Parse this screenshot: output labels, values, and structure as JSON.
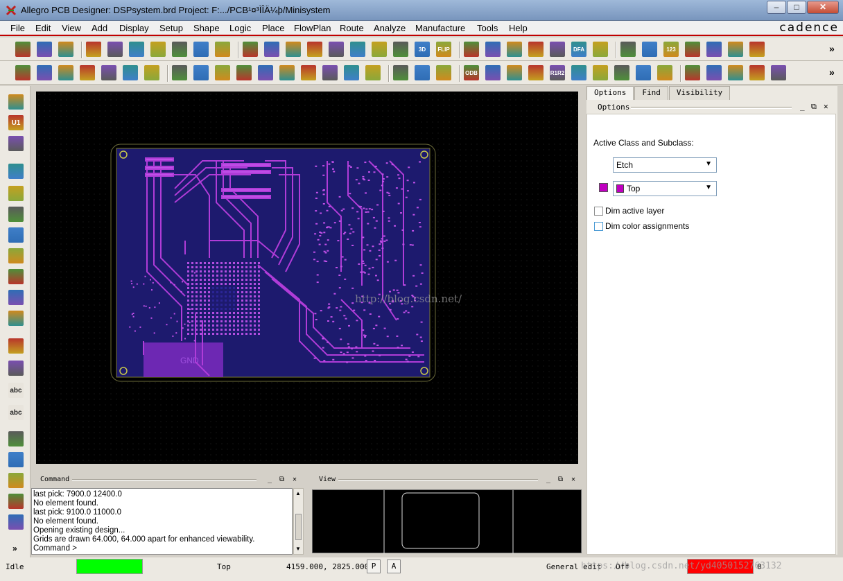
{
  "window": {
    "title": "Allegro PCB Designer: DSPsystem.brd  Project: F:.../PCB¹¤³ÌÎÄ¼þ/Minisystem",
    "minimize": "–",
    "maximize": "□",
    "close": "✕"
  },
  "menu": {
    "items": [
      "File",
      "Edit",
      "View",
      "Add",
      "Display",
      "Setup",
      "Shape",
      "Logic",
      "Place",
      "FlowPlan",
      "Route",
      "Analyze",
      "Manufacture",
      "Tools",
      "Help"
    ],
    "brand": "cadence"
  },
  "toolbar1": {
    "icons": [
      "new-icon",
      "open-icon",
      "save-icon",
      "move-icon",
      "copy-icon",
      "delete-icon",
      "undo-icon",
      "redo-icon",
      "add-connect-icon",
      "fix-icon",
      "grid-icon",
      "zoom-fit-icon",
      "zoom-points-icon",
      "zoom-in-icon",
      "zoom-out-icon",
      "zoom-prev-icon",
      "zoom-world-icon",
      "redraw-icon",
      "3d-icon",
      "flip-icon",
      "grid-display-icon",
      "color-icon",
      "layer-icon",
      "shape-fill-icon",
      "drc-icon",
      "dfa-icon",
      "3d-view-icon",
      "info-icon",
      "measure-icon",
      "label-123-icon",
      "highlight-icon",
      "sun-icon",
      "dehighlight-icon",
      "report-icon"
    ],
    "label_3d": "3D",
    "label_flip": "FLIP",
    "label_dfa": "DFA",
    "label_123": "123",
    "overflow": "»"
  },
  "toolbar2": {
    "icons": [
      "etch-icon-1",
      "etch-icon-2",
      "etch-icon-3",
      "etch-icon-4",
      "etch-icon-5",
      "etch-icon-6",
      "etch-icon-7",
      "line-icon",
      "rect-icon",
      "circle-icon",
      "select-icon",
      "shape-icon-1",
      "shape-icon-2",
      "shape-icon-3",
      "shape-icon-4",
      "shape-icon-5",
      "shape-icon-6",
      "place-icon",
      "dimension-icon",
      "dimension-2-icon",
      "odb-icon",
      "book-icon",
      "script-icon",
      "camera-icon",
      "refdes-icon",
      "flag-icon",
      "matrix-icon",
      "key-icon",
      "array-icon",
      "grid-array-icon",
      "wave-icon",
      "doc-icon",
      "doc-2-icon",
      "doc-3-icon",
      "window-icon"
    ],
    "label_odb": "ODB",
    "label_r1r2": "R1R2",
    "overflow": "»"
  },
  "left_toolbar": {
    "icons": [
      "place-manual-icon",
      "u1-icon",
      "component-icon",
      "add-line-icon",
      "slide-icon",
      "delay-tune-icon",
      "fanout-icon",
      "connect-icon",
      "bus-icon",
      "gloss-icon",
      "custom-smooth-icon",
      "line-draw-icon",
      "rectangle-icon",
      "text-add-icon",
      "text-edit-icon",
      "route-1-icon",
      "route-2-icon",
      "route-3-icon",
      "route-4-icon",
      "route-5-icon"
    ],
    "label_u1": "U1",
    "label_abc": "abc",
    "overflow": "»"
  },
  "canvas": {
    "watermark": "http://blog.csdn.net/",
    "silk_label": "GND"
  },
  "right_panel": {
    "tabs": [
      "Options",
      "Find",
      "Visibility"
    ],
    "panel_title": "Options",
    "active_class_label": "Active Class and Subclass:",
    "class_value": "Etch",
    "subclass_value": "Top",
    "subclass_color": "#c000c0",
    "dim_active_layer": "Dim active layer",
    "dim_color_assignments": "Dim color assignments",
    "dim_active_layer_checked": false,
    "dim_color_assignments_checked": false
  },
  "command_pane": {
    "title": "Command",
    "lines": [
      "last pick:  7900.0 12400.0",
      "No element found.",
      "last pick:  9100.0 11000.0",
      "No element found.",
      "Opening existing design...",
      "Grids are drawn 64.000, 64.000 apart for enhanced viewability.",
      "Command >"
    ]
  },
  "view_pane": {
    "title": "View"
  },
  "pane_controls": {
    "minimize": "_",
    "restore": "⧉",
    "close": "✕"
  },
  "status": {
    "state": "Idle",
    "layer": "Top",
    "coords": "4159.000, 2825.000",
    "p_button": "P",
    "a_button": "A",
    "mode": "General edit",
    "off": "Off",
    "drc_count": "0",
    "watermark": "https://blog.csdn.net/yd4050152763132",
    "idle_color": "#00ff00",
    "drc_color": "#ff0000"
  }
}
